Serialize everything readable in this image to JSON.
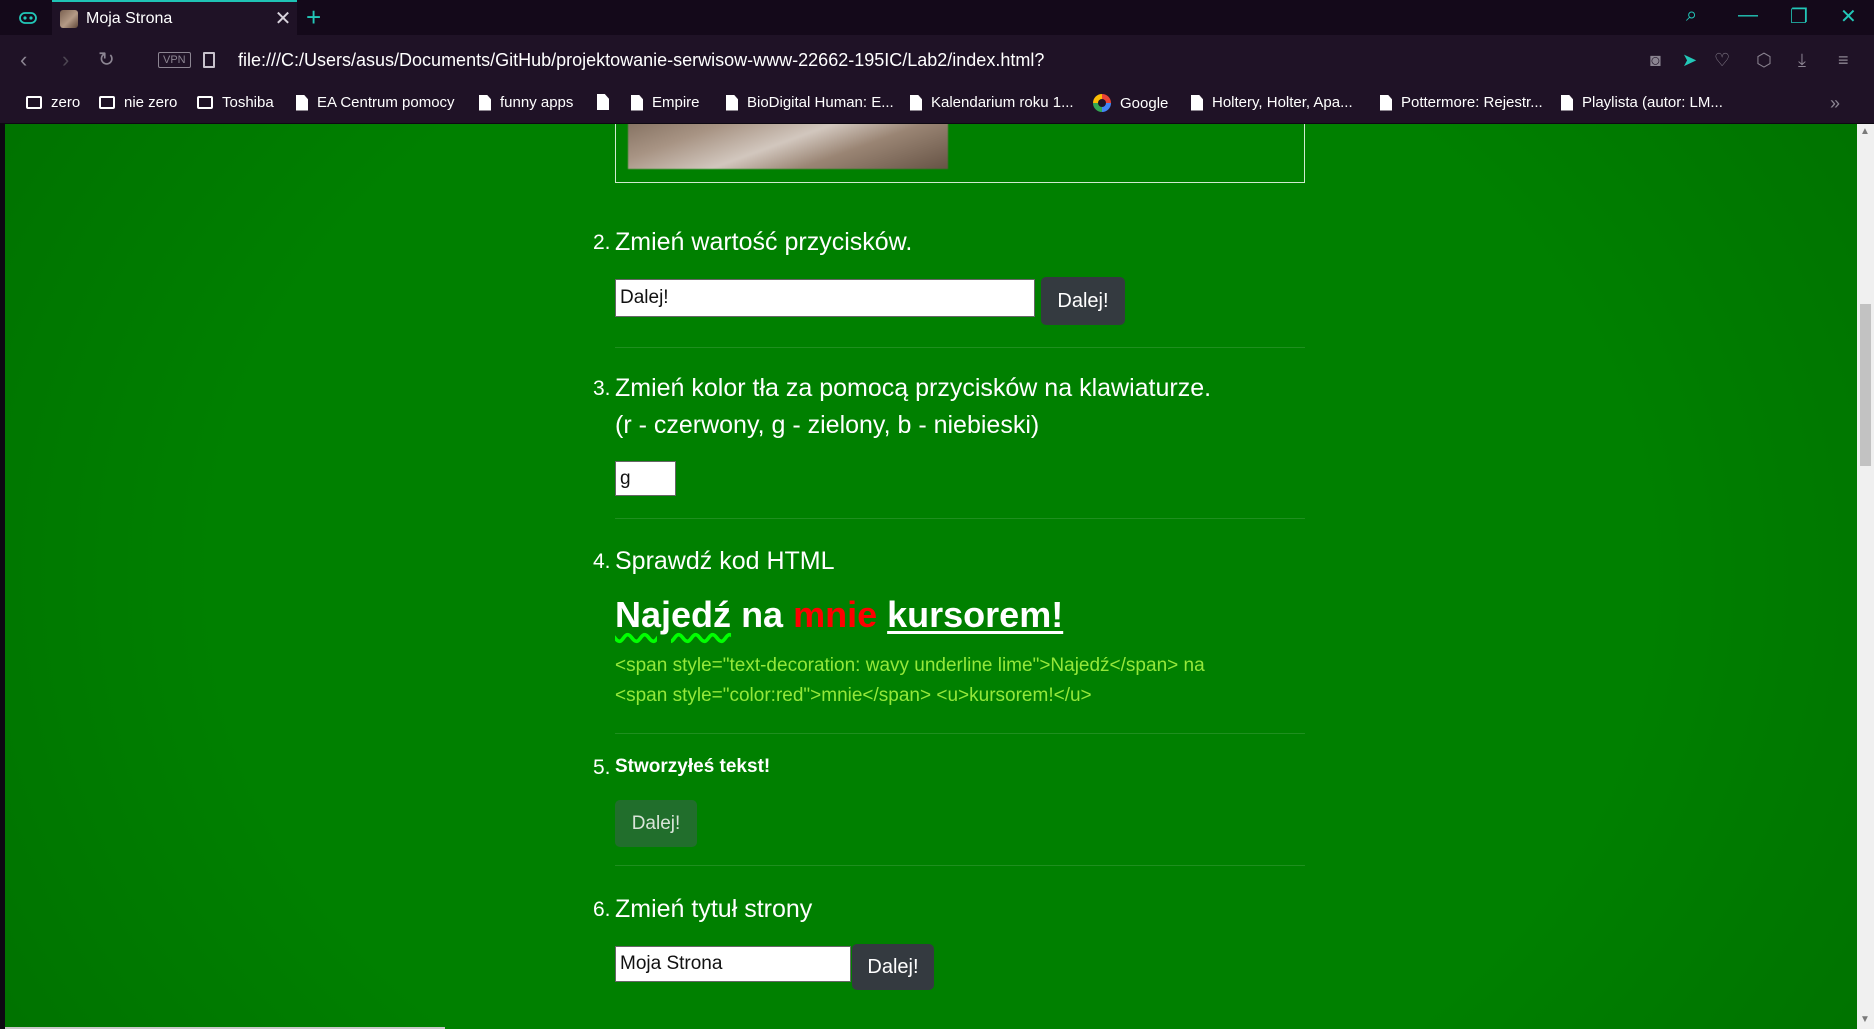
{
  "browser": {
    "tab_title": "Moja Strona",
    "url": "file:///C:/Users/asus/Documents/GitHub/projektowanie-serwisow-www-22662-195IC/Lab2/index.html?",
    "vpn_label": "VPN",
    "accent_color": "#1fc3b5"
  },
  "bookmarks": [
    {
      "label": "zero",
      "icon": "folder-icon"
    },
    {
      "label": "nie zero",
      "icon": "folder-icon"
    },
    {
      "label": "Toshiba",
      "icon": "folder-icon"
    },
    {
      "label": "EA Centrum pomocy",
      "icon": "file-icon"
    },
    {
      "label": "funny apps",
      "icon": "file-icon"
    },
    {
      "label": "",
      "icon": "file-icon"
    },
    {
      "label": "Empire",
      "icon": "file-icon"
    },
    {
      "label": "BioDigital Human: E...",
      "icon": "file-icon"
    },
    {
      "label": "Kalendarium roku 1...",
      "icon": "file-icon"
    },
    {
      "label": "Google",
      "icon": "google-icon"
    },
    {
      "label": "Holtery, Holter, Apa...",
      "icon": "file-icon"
    },
    {
      "label": "Pottermore: Rejestr...",
      "icon": "file-icon"
    },
    {
      "label": "Playlista (autor: LM...",
      "icon": "file-icon"
    }
  ],
  "page": {
    "background_color": "#008000",
    "items": {
      "two": {
        "number": "2.",
        "question": "Zmień wartość przycisków.",
        "input_value": "Dalej!",
        "button_label": "Dalej!"
      },
      "three": {
        "number": "3.",
        "question": "Zmień kolor tła za pomocą przycisków na klawiaturze.",
        "hint": "(r - czerwony, g - zielony, b - niebieski)",
        "input_value": "g"
      },
      "four": {
        "number": "4.",
        "question": "Sprawdź kod HTML",
        "heading_part1": "Najedź",
        "heading_part2": "na",
        "heading_part3": "mnie",
        "heading_part4": "kursorem!",
        "code_line1": "<span style=\"text-decoration: wavy underline lime\">Najedź</span> na",
        "code_line2": "<span style=\"color:red\">mnie</span> <u>kursorem!</u>"
      },
      "five": {
        "number": "5.",
        "question": "Stworzyłeś tekst!",
        "button_label": "Dalej!"
      },
      "six": {
        "number": "6.",
        "question": "Zmień tytuł strony",
        "input_value": "Moja Strona",
        "button_label": "Dalej!"
      }
    }
  }
}
